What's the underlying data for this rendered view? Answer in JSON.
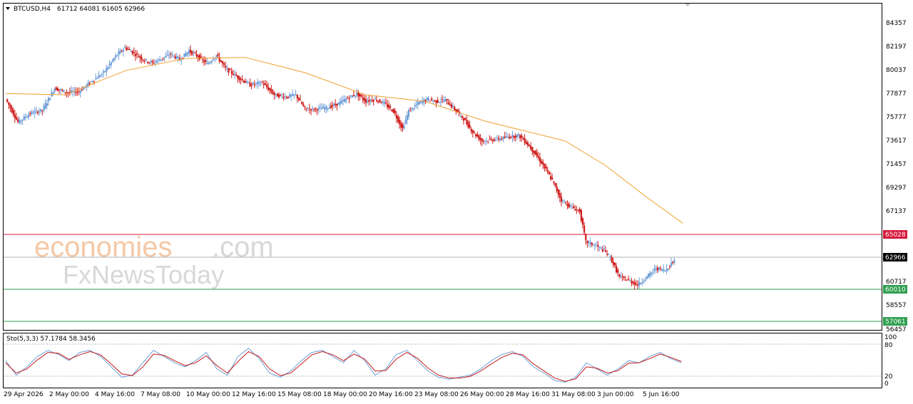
{
  "header": {
    "symbol": "BTCUSD,H4",
    "ohlc": "61712 64081 61605 62966",
    "dropdown_icon": "triangle-down-icon"
  },
  "watermark": {
    "line1_accent": "economies",
    "line1_rest": ".com",
    "line2": "FxNewsToday"
  },
  "price_axis": {
    "ticks": [
      "84357",
      "82197",
      "80037",
      "77877",
      "75777",
      "73617",
      "71457",
      "69297",
      "67137",
      "62966",
      "60717",
      "58557",
      "56457"
    ]
  },
  "levels": {
    "resistance": {
      "value": "65028",
      "color": "#d6173a"
    },
    "current": {
      "value": "62966",
      "color": "#000000"
    },
    "support1": {
      "value": "60010",
      "color": "#2e9e4f"
    },
    "support2": {
      "value": "57061",
      "color": "#2e9e4f"
    }
  },
  "time_axis": {
    "labels": [
      "29 Apr 2026",
      "2 May 00:00",
      "4 May 16:00",
      "7 May 08:00",
      "10 May 00:00",
      "12 May 16:00",
      "15 May 08:00",
      "18 May 00:00",
      "20 May 16:00",
      "23 May 08:00",
      "26 May 00:00",
      "28 May 16:00",
      "31 May 08:00",
      "3 Jun 00:00",
      "5 Jun 16:00"
    ]
  },
  "oscillator": {
    "label": "Sto(5,3,3) 57.1784 58.3456",
    "ticks": [
      "100",
      "80",
      "20",
      "0"
    ]
  },
  "colors": {
    "bull": "#6f9fd8",
    "bear": "#d01a1a",
    "ma": "#f0a030",
    "stoch_main": "#6f9fd8",
    "stoch_signal": "#c41a1a"
  },
  "chart_data": {
    "type": "candlestick",
    "ylim": [
      56000,
      85000
    ],
    "close_path": [
      [
        0,
        77600
      ],
      [
        8,
        75500
      ],
      [
        16,
        76300
      ],
      [
        24,
        76600
      ],
      [
        32,
        78600
      ],
      [
        40,
        78200
      ],
      [
        48,
        78300
      ],
      [
        56,
        79200
      ],
      [
        64,
        80000
      ],
      [
        72,
        81500
      ],
      [
        78,
        82300
      ],
      [
        84,
        81800
      ],
      [
        90,
        81200
      ],
      [
        96,
        80900
      ],
      [
        102,
        81300
      ],
      [
        108,
        81700
      ],
      [
        114,
        81200
      ],
      [
        120,
        82000
      ],
      [
        126,
        81500
      ],
      [
        132,
        80800
      ],
      [
        138,
        81600
      ],
      [
        144,
        80400
      ],
      [
        152,
        79600
      ],
      [
        160,
        78900
      ],
      [
        168,
        79100
      ],
      [
        176,
        78000
      ],
      [
        184,
        77800
      ],
      [
        190,
        78000
      ],
      [
        196,
        76700
      ],
      [
        204,
        76700
      ],
      [
        210,
        76800
      ],
      [
        218,
        77200
      ],
      [
        224,
        77700
      ],
      [
        230,
        78100
      ],
      [
        236,
        77400
      ],
      [
        242,
        77600
      ],
      [
        248,
        77200
      ],
      [
        254,
        76500
      ],
      [
        260,
        74900
      ],
      [
        264,
        76500
      ],
      [
        270,
        77200
      ],
      [
        276,
        77600
      ],
      [
        282,
        77400
      ],
      [
        288,
        77500
      ],
      [
        294,
        76700
      ],
      [
        300,
        75800
      ],
      [
        306,
        74600
      ],
      [
        312,
        73800
      ],
      [
        318,
        73900
      ],
      [
        324,
        74000
      ],
      [
        330,
        74200
      ],
      [
        336,
        74300
      ],
      [
        340,
        73800
      ],
      [
        346,
        72800
      ],
      [
        352,
        71600
      ],
      [
        358,
        70200
      ],
      [
        364,
        68400
      ],
      [
        370,
        67800
      ],
      [
        376,
        67400
      ],
      [
        380,
        64600
      ],
      [
        386,
        64300
      ],
      [
        392,
        63800
      ],
      [
        396,
        63200
      ],
      [
        402,
        61400
      ],
      [
        408,
        61100
      ],
      [
        414,
        60700
      ],
      [
        420,
        61400
      ],
      [
        426,
        62200
      ],
      [
        432,
        62000
      ],
      [
        438,
        62966
      ]
    ],
    "moving_average": [
      [
        0,
        78100
      ],
      [
        60,
        78000
      ],
      [
        120,
        80200
      ],
      [
        180,
        81300
      ],
      [
        240,
        81400
      ],
      [
        300,
        80000
      ],
      [
        360,
        78000
      ],
      [
        420,
        77400
      ],
      [
        480,
        75600
      ],
      [
        520,
        74700
      ],
      [
        560,
        73800
      ],
      [
        600,
        71600
      ],
      [
        640,
        68800
      ],
      [
        678,
        66300
      ]
    ],
    "horizontal_levels": [
      65028,
      62966,
      60010,
      57061
    ],
    "stochastic": {
      "ylim": [
        0,
        100
      ],
      "levels": [
        20,
        80
      ],
      "main": [
        [
          0,
          60
        ],
        [
          10,
          25
        ],
        [
          20,
          45
        ],
        [
          30,
          70
        ],
        [
          40,
          85
        ],
        [
          50,
          75
        ],
        [
          60,
          60
        ],
        [
          70,
          80
        ],
        [
          80,
          85
        ],
        [
          90,
          70
        ],
        [
          100,
          45
        ],
        [
          110,
          20
        ],
        [
          120,
          25
        ],
        [
          130,
          55
        ],
        [
          140,
          85
        ],
        [
          150,
          70
        ],
        [
          160,
          55
        ],
        [
          170,
          45
        ],
        [
          180,
          60
        ],
        [
          190,
          80
        ],
        [
          200,
          40
        ],
        [
          210,
          25
        ],
        [
          220,
          70
        ],
        [
          230,
          90
        ],
        [
          240,
          65
        ],
        [
          250,
          30
        ],
        [
          260,
          20
        ],
        [
          270,
          35
        ],
        [
          280,
          60
        ],
        [
          290,
          80
        ],
        [
          300,
          85
        ],
        [
          310,
          70
        ],
        [
          320,
          55
        ],
        [
          330,
          85
        ],
        [
          340,
          60
        ],
        [
          350,
          25
        ],
        [
          360,
          40
        ],
        [
          370,
          75
        ],
        [
          380,
          85
        ],
        [
          390,
          60
        ],
        [
          400,
          35
        ],
        [
          410,
          20
        ],
        [
          420,
          15
        ],
        [
          430,
          20
        ],
        [
          440,
          25
        ],
        [
          450,
          40
        ],
        [
          460,
          60
        ],
        [
          470,
          75
        ],
        [
          480,
          82
        ],
        [
          490,
          70
        ],
        [
          500,
          45
        ],
        [
          510,
          30
        ],
        [
          520,
          12
        ],
        [
          530,
          8
        ],
        [
          540,
          20
        ],
        [
          550,
          55
        ],
        [
          560,
          40
        ],
        [
          570,
          25
        ],
        [
          580,
          40
        ],
        [
          590,
          60
        ],
        [
          600,
          55
        ],
        [
          610,
          70
        ],
        [
          620,
          80
        ],
        [
          630,
          65
        ],
        [
          640,
          55
        ]
      ],
      "signal": [
        [
          0,
          55
        ],
        [
          10,
          30
        ],
        [
          20,
          40
        ],
        [
          30,
          62
        ],
        [
          40,
          80
        ],
        [
          50,
          78
        ],
        [
          60,
          63
        ],
        [
          70,
          74
        ],
        [
          80,
          82
        ],
        [
          90,
          74
        ],
        [
          100,
          52
        ],
        [
          110,
          28
        ],
        [
          120,
          24
        ],
        [
          130,
          45
        ],
        [
          140,
          76
        ],
        [
          150,
          73
        ],
        [
          160,
          60
        ],
        [
          170,
          48
        ],
        [
          180,
          55
        ],
        [
          190,
          72
        ],
        [
          200,
          48
        ],
        [
          210,
          30
        ],
        [
          220,
          58
        ],
        [
          230,
          82
        ],
        [
          240,
          70
        ],
        [
          250,
          40
        ],
        [
          260,
          24
        ],
        [
          270,
          30
        ],
        [
          280,
          52
        ],
        [
          290,
          74
        ],
        [
          300,
          82
        ],
        [
          310,
          74
        ],
        [
          320,
          60
        ],
        [
          330,
          76
        ],
        [
          340,
          64
        ],
        [
          350,
          35
        ],
        [
          360,
          36
        ],
        [
          370,
          64
        ],
        [
          380,
          80
        ],
        [
          390,
          66
        ],
        [
          400,
          42
        ],
        [
          410,
          25
        ],
        [
          420,
          18
        ],
        [
          430,
          18
        ],
        [
          440,
          22
        ],
        [
          450,
          35
        ],
        [
          460,
          52
        ],
        [
          470,
          68
        ],
        [
          480,
          78
        ],
        [
          490,
          74
        ],
        [
          500,
          52
        ],
        [
          510,
          35
        ],
        [
          520,
          18
        ],
        [
          530,
          10
        ],
        [
          540,
          16
        ],
        [
          550,
          45
        ],
        [
          560,
          42
        ],
        [
          570,
          30
        ],
        [
          580,
          36
        ],
        [
          590,
          54
        ],
        [
          600,
          55
        ],
        [
          610,
          65
        ],
        [
          620,
          76
        ],
        [
          630,
          68
        ],
        [
          640,
          58
        ]
      ]
    }
  }
}
